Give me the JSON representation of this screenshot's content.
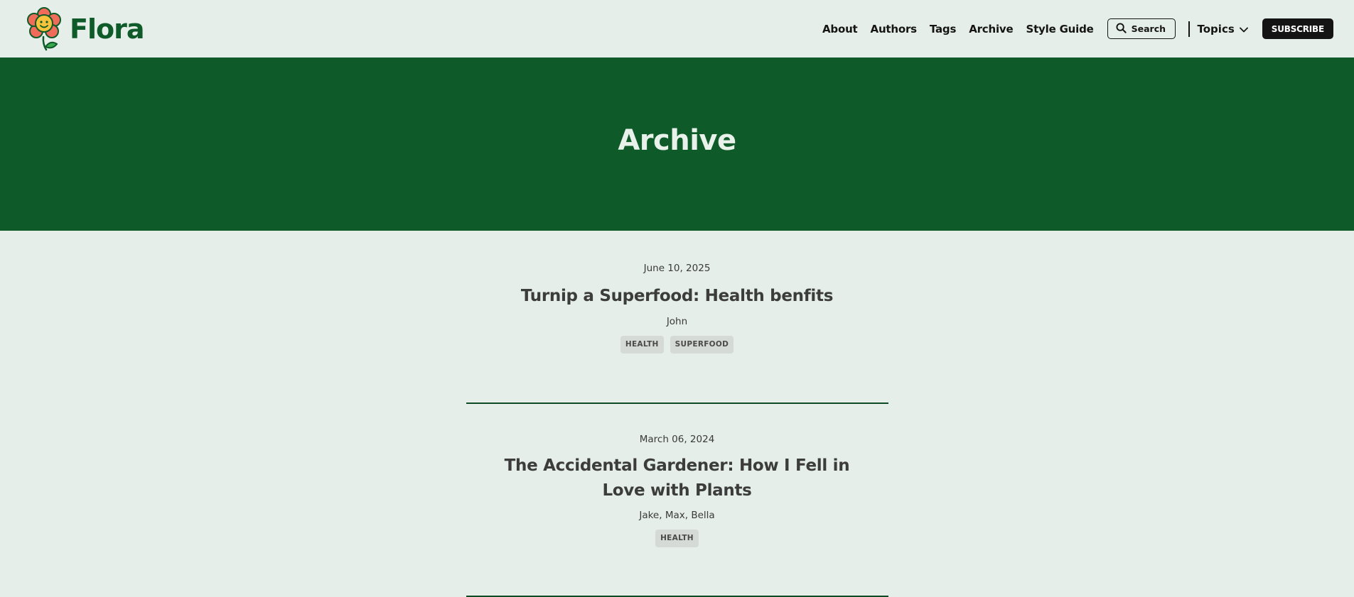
{
  "brand": {
    "name": "Flora",
    "logo_icon": "smiling-flower-icon",
    "colors": {
      "primary": "#0e5a28",
      "petal": "#f06b5a",
      "face": "#f7c23c"
    }
  },
  "nav": {
    "links": [
      "About",
      "Authors",
      "Tags",
      "Archive",
      "Style Guide"
    ],
    "search_label": "Search",
    "topics_label": "Topics",
    "subscribe_label": "SUBSCRIBE"
  },
  "hero": {
    "title": "Archive"
  },
  "posts": [
    {
      "date": "June 10, 2025",
      "title": "Turnip a Superfood: Health benfits",
      "authors": "John",
      "tags": [
        "HEALTH",
        "SUPERFOOD"
      ]
    },
    {
      "date": "March 06, 2024",
      "title": "The Accidental Gardener: How I Fell in Love with Plants",
      "authors": "Jake, Max, Bella",
      "tags": [
        "HEALTH"
      ]
    }
  ]
}
